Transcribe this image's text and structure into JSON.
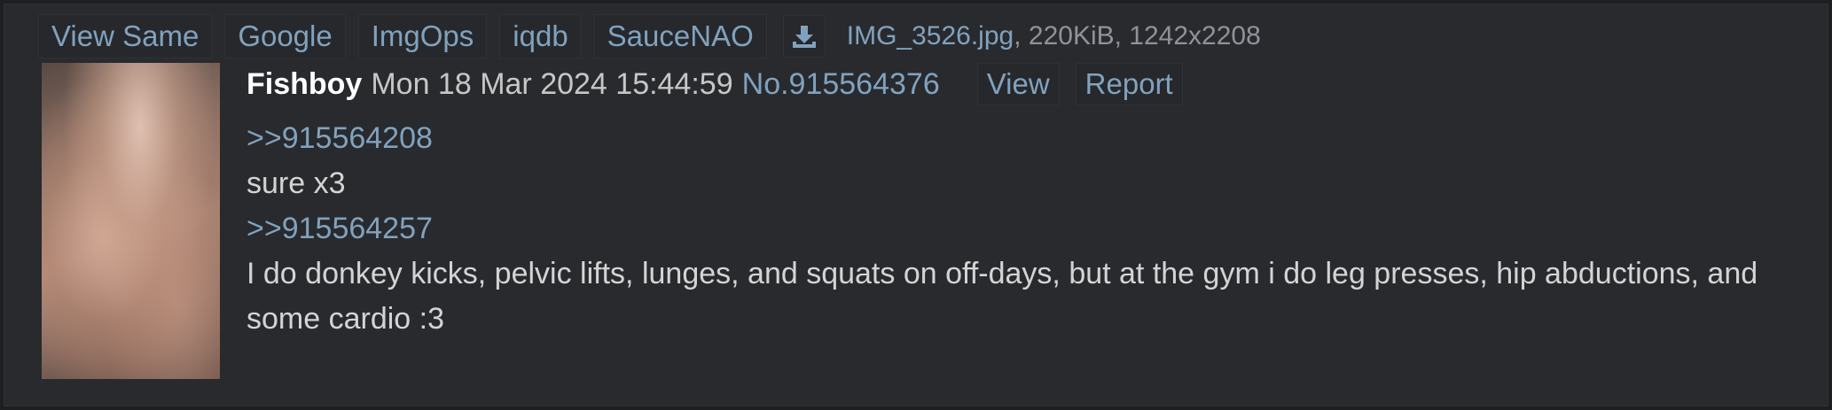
{
  "topbar": {
    "links": [
      {
        "label": "View Same"
      },
      {
        "label": "Google"
      },
      {
        "label": "ImgOps"
      },
      {
        "label": "iqdb"
      },
      {
        "label": "SauceNAO"
      }
    ],
    "download_icon": "download-icon",
    "file": {
      "name": "IMG_3526.jpg",
      "meta": ", 220KiB, 1242x2208"
    }
  },
  "post": {
    "name": "Fishboy",
    "date": "Mon 18 Mar 2024 15:44:59",
    "number": "No.915564376",
    "view_label": "View",
    "report_label": "Report",
    "lines": [
      {
        "type": "quote",
        "text": ">>915564208"
      },
      {
        "type": "text",
        "text": "sure x3"
      },
      {
        "type": "quote",
        "text": ">>915564257"
      },
      {
        "type": "text",
        "text": "I do donkey kicks, pelvic lifts, lunges, and squats on off-days, but at the gym i do leg presses, hip abductions, and some cardio :3"
      }
    ]
  },
  "colors": {
    "background": "#282a2e",
    "link": "#81a2be",
    "text": "#d2d5d3",
    "name": "#ffffff"
  }
}
